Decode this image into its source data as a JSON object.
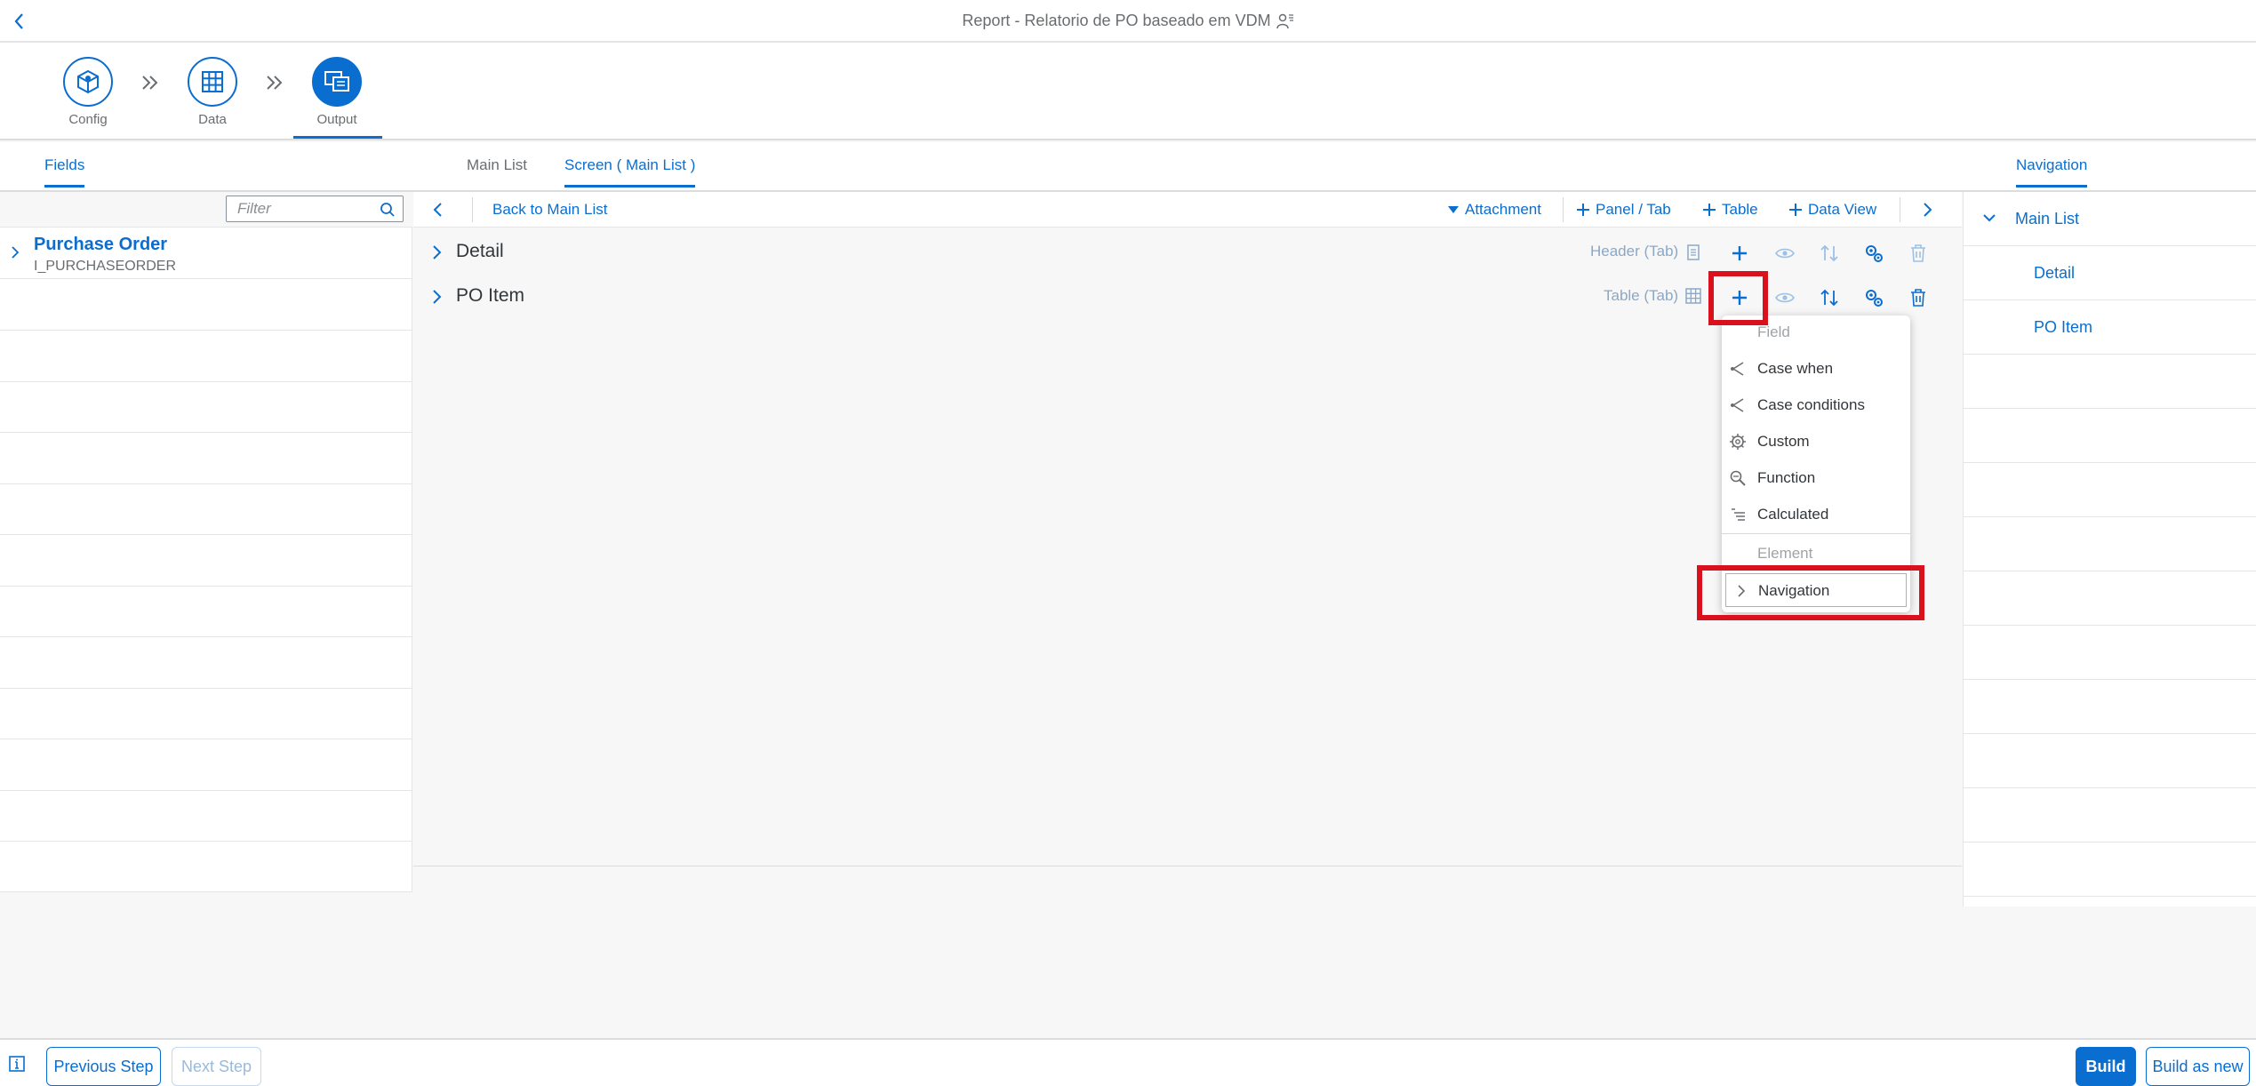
{
  "shell": {
    "title": "Report - Relatorio de PO baseado em VDM"
  },
  "steps": [
    {
      "label": "Config"
    },
    {
      "label": "Data"
    },
    {
      "label": "Output"
    }
  ],
  "left_tabs": {
    "fields": "Fields"
  },
  "center_tabs": {
    "main_list": "Main List",
    "screen": "Screen ( Main List )"
  },
  "right_tabs": {
    "navigation": "Navigation"
  },
  "filter": {
    "placeholder": "Filter"
  },
  "fields": {
    "entity_name": "Purchase Order",
    "entity_tech": "I_PURCHASEORDER"
  },
  "toolbar": {
    "back_to_main": "Back to Main List",
    "attachment": "Attachment",
    "panel_tab": "Panel / Tab",
    "table": "Table",
    "data_view": "Data View"
  },
  "elements": [
    {
      "title": "Detail",
      "type": "Header (Tab)"
    },
    {
      "title": "PO Item",
      "type": "Table (Tab)"
    }
  ],
  "menu": {
    "field_header": "Field",
    "items": [
      "Case when",
      "Case conditions",
      "Custom",
      "Function",
      "Calculated"
    ],
    "element_header": "Element",
    "navigation": "Navigation"
  },
  "navigation_tree": {
    "root": "Main List",
    "children": [
      "Detail",
      "PO Item"
    ]
  },
  "footer": {
    "previous": "Previous Step",
    "next": "Next Step",
    "build": "Build",
    "build_new": "Build as new"
  },
  "colors": {
    "accent": "#0a6ed1",
    "highlight": "#d8111c",
    "muted_link": "#8aa8c7"
  }
}
